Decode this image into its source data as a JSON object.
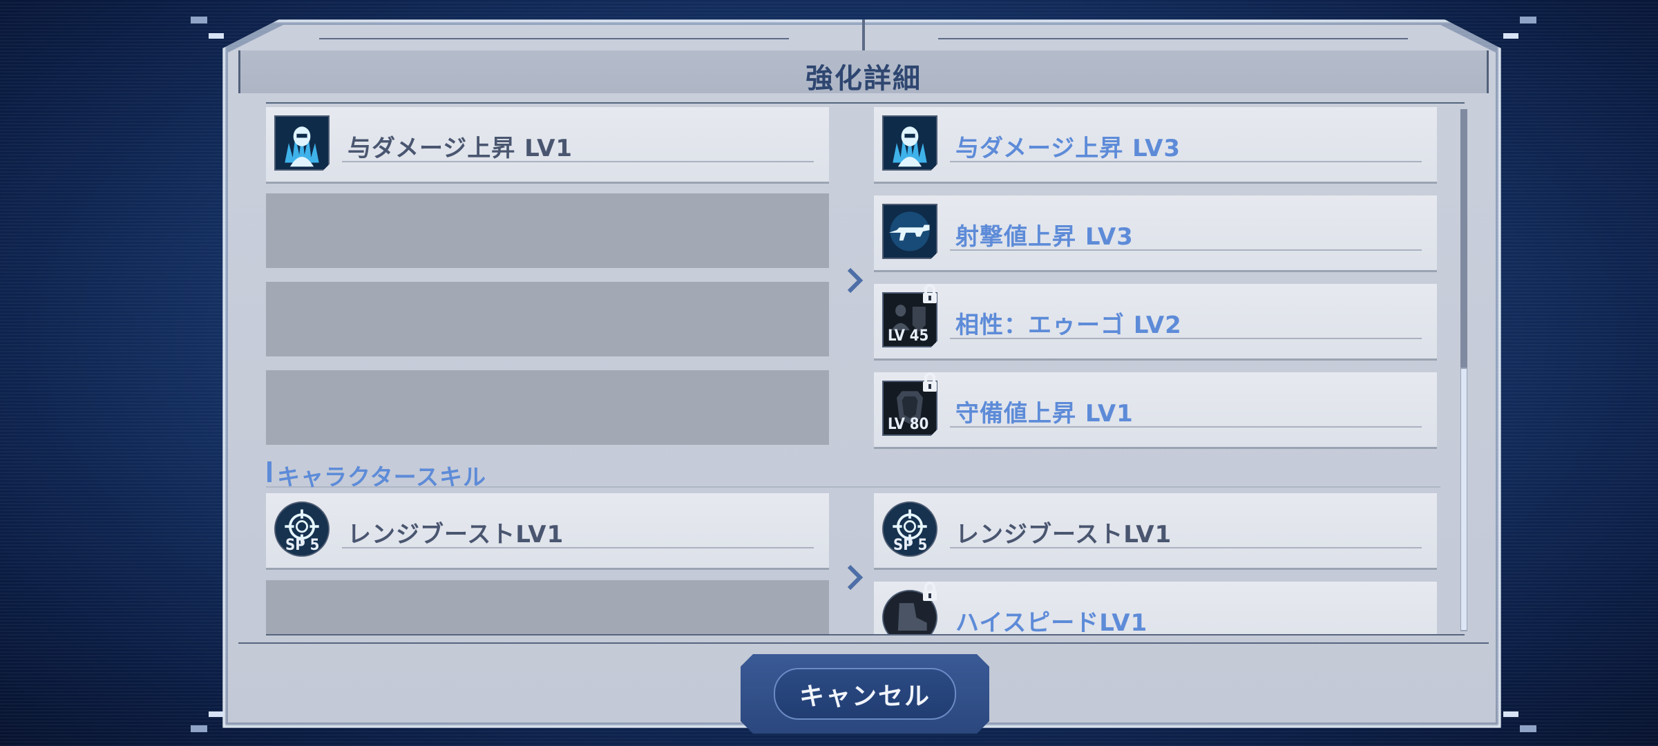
{
  "dialog": {
    "title": "強化詳細",
    "cancel_label": "キャンセル"
  },
  "colors": {
    "accent_blue": "#5d8bd8",
    "label_gray": "#4a5670",
    "button_navy": "#2b477e"
  },
  "enhancements": {
    "before": [
      {
        "label": "与ダメージ上昇 LV1",
        "icon": "pilot-damage-icon"
      }
    ],
    "after": [
      {
        "label": "与ダメージ上昇 LV3",
        "icon": "pilot-damage-icon",
        "locked": false
      },
      {
        "label": "射撃値上昇 LV3",
        "icon": "rifle-icon",
        "locked": false
      },
      {
        "label": "相性：エゥーゴ LV2",
        "icon": "faction-pilot-icon",
        "locked": true,
        "required_level": "LV 45"
      },
      {
        "label": "守備値上昇 LV1",
        "icon": "shield-icon",
        "locked": true,
        "required_level": "LV 80"
      }
    ]
  },
  "character_skills": {
    "section_title": "キャラクタースキル",
    "before": [
      {
        "label": "レンジブーストLV1",
        "icon": "crosshair-icon",
        "sp": "SP 5"
      }
    ],
    "after": [
      {
        "label": "レンジブーストLV1",
        "icon": "crosshair-icon",
        "sp": "SP 5"
      },
      {
        "label": "ハイスピードLV1",
        "icon": "boot-icon",
        "locked": true
      }
    ]
  }
}
